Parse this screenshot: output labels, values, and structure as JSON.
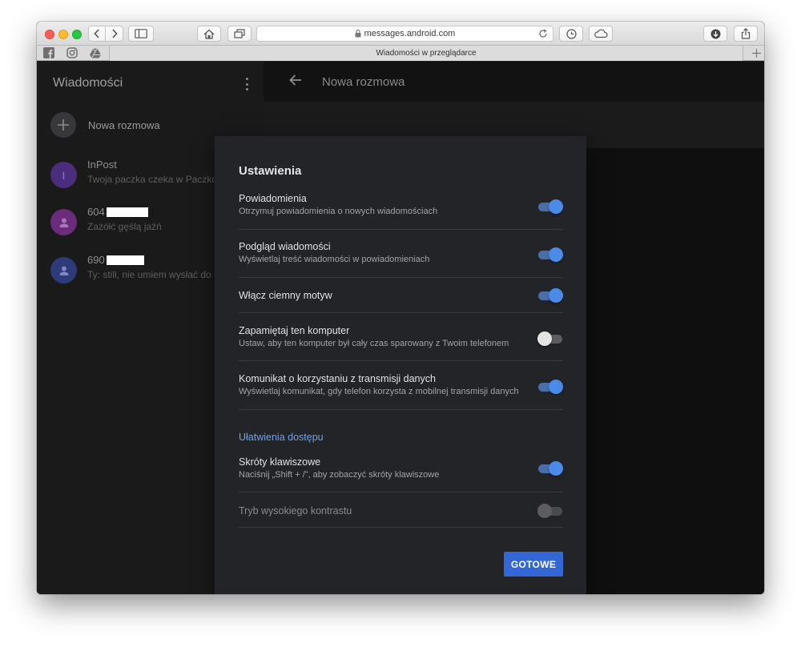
{
  "browser": {
    "url": "messages.android.com",
    "tab_title": "Wiadomości w przeglądarce",
    "favorites": [
      "facebook-icon",
      "instagram-icon",
      "google-drive-icon"
    ]
  },
  "sidebar": {
    "title": "Wiadomości",
    "new_conversation_label": "Nowa rozmowa",
    "conversations": [
      {
        "name": "InPost",
        "avatar_letter": "I",
        "avatar_color": "#4a2d7c",
        "snippet": "Twoja paczka czeka w Paczkomacie"
      },
      {
        "name": "604",
        "avatar_color": "#6b2c7e",
        "snippet": "Zażółć gęślą jaźń",
        "redacted": true
      },
      {
        "name": "690",
        "avatar_color": "#2e3b7a",
        "snippet": "Ty: still, nie umiem wysłać do ciebie",
        "redacted": true
      }
    ]
  },
  "header": {
    "title": "Nowa rozmowa"
  },
  "dialog": {
    "title": "Ustawienia",
    "settings": [
      {
        "title": "Powiadomienia",
        "description": "Otrzymuj powiadomienia o nowych wiadomościach",
        "enabled": true
      },
      {
        "title": "Podgląd wiadomości",
        "description": "Wyświetlaj treść wiadomości w powiadomieniach",
        "enabled": true
      },
      {
        "title": "Włącz ciemny motyw",
        "description": "",
        "enabled": true
      },
      {
        "title": "Zapamiętaj ten komputer",
        "description": "Ustaw, aby ten komputer był cały czas sparowany z Twoim telefonem",
        "enabled": false
      },
      {
        "title": "Komunikat o korzystaniu z transmisji danych",
        "description": "Wyświetlaj komunikat, gdy telefon korzysta z mobilnej transmisji danych",
        "enabled": true
      }
    ],
    "accessibility_heading": "Ułatwienia dostępu",
    "accessibility_settings": [
      {
        "title": "Skróty klawiszowe",
        "description": "Naciśnij „Shift + /”, aby zobaczyć skróty klawiszowe",
        "enabled": true
      },
      {
        "title": "Tryb wysokiego kontrastu",
        "description": "",
        "enabled": false,
        "disabled": true
      }
    ],
    "done_label": "GOTOWE"
  },
  "colors": {
    "accent": "#3367d6",
    "toggle_on": "#4a8ae8",
    "section_heading": "#6fa1e8"
  }
}
